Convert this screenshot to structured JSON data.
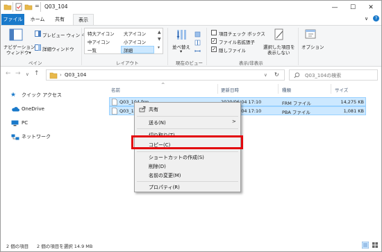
{
  "window": {
    "title": "Q03_104",
    "qa_separator": "=",
    "controls": {
      "minimize": "—",
      "maximize": "☐",
      "close": "✕"
    }
  },
  "tabs": [
    {
      "label": "ファイル"
    },
    {
      "label": "ホーム"
    },
    {
      "label": "共有"
    },
    {
      "label": "表示"
    }
  ],
  "ribbon": {
    "collapse_icon": "∨",
    "help_icon": "?",
    "pane_group": {
      "nav_pane_line1": "ナビゲーション",
      "nav_pane_line2": "ウィンドウ▾",
      "preview_pane": "プレビュー ウィンドウ",
      "details_pane": "詳細ウィンドウ",
      "label": "ペイン"
    },
    "layout_group": {
      "items": [
        "特大アイコン",
        "大アイコン",
        "中アイコン",
        "小アイコン",
        "一覧",
        "詳細"
      ],
      "selected": "詳細",
      "label": "レイアウト"
    },
    "view_group": {
      "sort_line1": "並べ替え",
      "sort_line2": "▾",
      "label": "現在のビュー"
    },
    "showhide_group": {
      "item_checkbox": {
        "label": "項目チェック ボックス",
        "checked": false
      },
      "file_ext": {
        "label": "ファイル名拡張子",
        "checked": true
      },
      "hidden_files": {
        "label": "隠しファイル",
        "checked": true
      },
      "hide_selected_line1": "選択した項目を",
      "hide_selected_line2": "表示しない",
      "options": "オプション",
      "label": "表示/非表示"
    }
  },
  "address": {
    "back": "←",
    "forward": "→",
    "dropdown": "∨",
    "up": "↑",
    "chevron": "›",
    "path": "Q03_104",
    "path_dropdown": "∨",
    "refresh": "↻",
    "search_placeholder": "Q03_104の検索"
  },
  "nav_pane": {
    "items": [
      {
        "label": "クイック アクセス"
      },
      {
        "label": "OneDrive"
      },
      {
        "label": "PC"
      },
      {
        "label": "ネットワーク"
      }
    ]
  },
  "file_list": {
    "sort_indicator": "^",
    "columns": [
      "名前",
      "更新日時",
      "種類",
      "サイズ"
    ],
    "rows": [
      {
        "name": "Q03_104.frm",
        "date": "2020/06/04 17:10",
        "type": "FRM ファイル",
        "size": "14,275 KB"
      },
      {
        "name": "Q03_104.pba",
        "date": "2020/06/04 17:10",
        "type": "PBA ファイル",
        "size": "1,081 KB"
      }
    ]
  },
  "context_menu": {
    "items": [
      {
        "label": "共有",
        "icon": "share-icon"
      },
      {
        "label": "送る(N)",
        "submenu": ">"
      },
      {
        "label": "切り取り(T)"
      },
      {
        "label": "コピー(C)"
      },
      {
        "label": "ショートカットの作成(S)"
      },
      {
        "label": "削除(D)"
      },
      {
        "label": "名前の変更(M)"
      },
      {
        "label": "プロパティ(R)"
      }
    ]
  },
  "status_bar": {
    "item_count": "2 個の項目",
    "selected": "2 個の項目を選択 14.9 MB"
  },
  "colors": {
    "accent": "#1979ca",
    "selection": "#cce8ff",
    "highlight_box": "#e3070d"
  }
}
